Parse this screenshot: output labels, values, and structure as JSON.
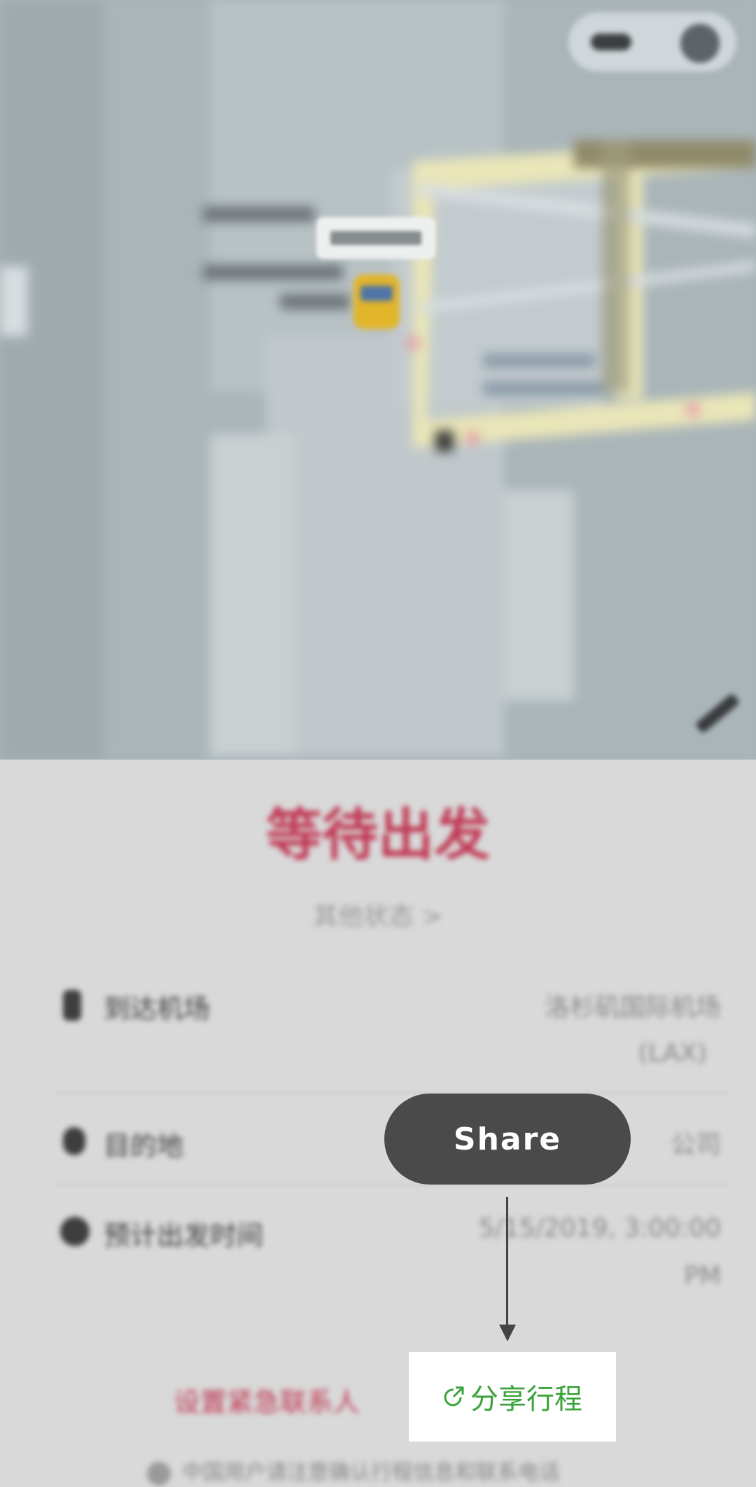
{
  "map": {
    "labels": [
      "Coffee B",
      "Coffee Bean",
      "Tea L",
      "Los Angeles",
      "Int'l Airport"
    ],
    "pickup_tag": "候车点"
  },
  "status": {
    "title": "等待出发",
    "link": "其他状态 >"
  },
  "details": [
    {
      "icon": "phone-icon",
      "label": "到达机场",
      "value_line1": "洛杉矶国际机场",
      "value_line2": "(LAX)"
    },
    {
      "icon": "pin-icon",
      "label": "目的地",
      "value_line1": "公司",
      "value_line2": ""
    },
    {
      "icon": "clock-icon",
      "label": "预计出发时间",
      "value_line1": "5/15/2019, 3:00:00",
      "value_line2": "PM"
    }
  ],
  "actions": {
    "contact_label": "设置紧急联系人",
    "share_label": "分享行程"
  },
  "footer": {
    "note": "中国用户请注意确认行程信息和联系电话"
  },
  "tooltip": {
    "label": "Share"
  },
  "colors": {
    "accent_red": "#c03a55",
    "share_green": "#3aa33a",
    "tooltip_bg": "#4a4a4a"
  }
}
